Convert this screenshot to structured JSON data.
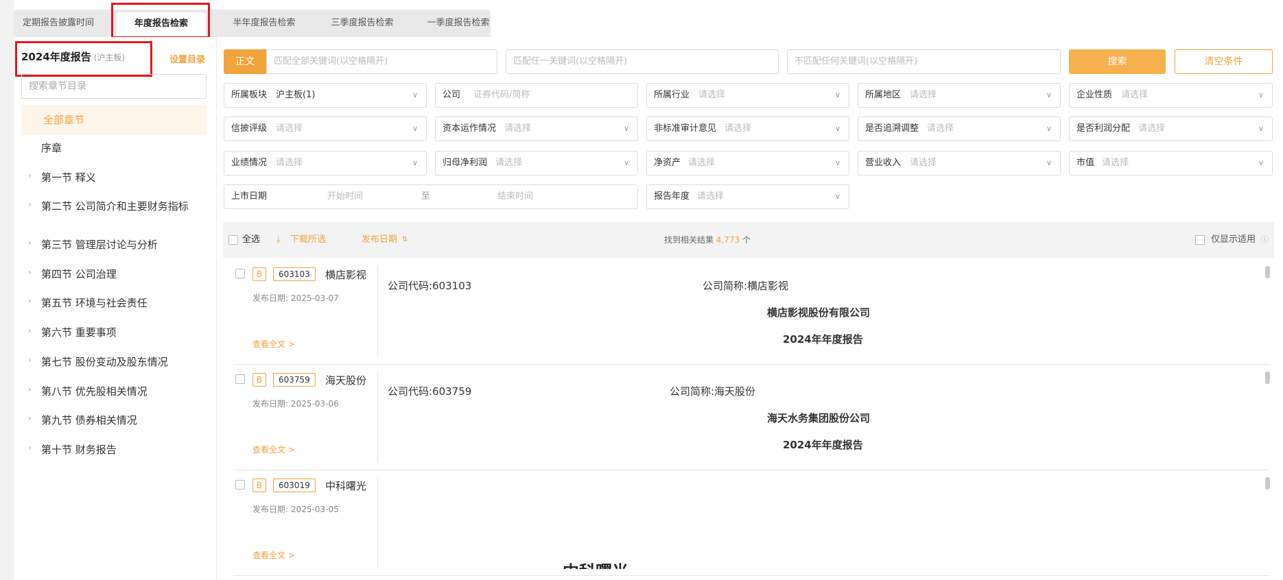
{
  "tabs": [
    {
      "label": "定期报告披露时间"
    },
    {
      "label": "年度报告检索"
    },
    {
      "label": "半年度报告检索"
    },
    {
      "label": "三季度报告检索"
    },
    {
      "label": "一季度报告检索"
    }
  ],
  "sidebar": {
    "title": "2024年度报告",
    "title_sub": "(沪主板)",
    "set_link": "设置目录",
    "search_placeholder": "搜索章节目录",
    "all_chapters": "全部章节",
    "chapters": [
      {
        "label": "序章"
      },
      {
        "label": "第一节 释义"
      },
      {
        "label": "第二节 公司简介和主要财务指标"
      },
      {
        "label": "第三节 管理层讨论与分析"
      },
      {
        "label": "第四节 公司治理"
      },
      {
        "label": "第五节 环境与社会责任"
      },
      {
        "label": "第六节 重要事项"
      },
      {
        "label": "第七节 股份变动及股东情况"
      },
      {
        "label": "第八节 优先股相关情况"
      },
      {
        "label": "第九节 债券相关情况"
      },
      {
        "label": "第十节 财务报告"
      }
    ]
  },
  "search": {
    "body_btn": "正文",
    "any_ph": "匹配全部关键词(以空格隔开)",
    "one_ph": "匹配任一关键词(以空格隔开)",
    "none_ph": "不匹配任何关键词(以空格隔开)",
    "search_btn": "搜索",
    "clear_btn": "清空条件"
  },
  "filters": {
    "board_label": "所属板块",
    "board_value": "沪主板(1)",
    "company_label": "公司",
    "company_ph": "证券代码/简称",
    "industry_label": "所属行业",
    "region_label": "所属地区",
    "nature_label": "企业性质",
    "rating_label": "信披评级",
    "capital_label": "资本运作情况",
    "audit_label": "非标准审计意见",
    "restate_label": "是否追溯调整",
    "dividend_label": "是否利润分配",
    "perf_label": "业绩情况",
    "netprofit_label": "归母净利润",
    "netasset_label": "净资产",
    "revenue_label": "营业收入",
    "mktcap_label": "市值",
    "listdate_label": "上市日期",
    "start_ph": "开始时间",
    "to": "至",
    "end_ph": "结束时间",
    "year_label": "报告年度",
    "select_ph": "请选择"
  },
  "results_bar": {
    "select_all": "全选",
    "download": "下载所选",
    "sort": "发布日期",
    "found_prefix": "找到相关结果",
    "count": "4,773",
    "found_suffix": "个",
    "only_applicable": "仅显示适用"
  },
  "results": [
    {
      "badge": "B",
      "code": "603103",
      "name": "横店影视",
      "date_label": "发布日期:",
      "date": "2025-03-07",
      "view": "查看全文 >",
      "code_line": "公司代码:603103",
      "short_line": "公司简称:横店影视",
      "company_full": "横店影视股份有限公司",
      "report_title": "2024年年度报告"
    },
    {
      "badge": "B",
      "code": "603759",
      "name": "海天股份",
      "date_label": "发布日期:",
      "date": "2025-03-06",
      "view": "查看全文 >",
      "code_line": "公司代码:603759",
      "short_line": "公司简称:海天股份",
      "company_full": "海天水务集团股份公司",
      "report_title": "2024年年度报告"
    },
    {
      "badge": "B",
      "code": "603019",
      "name": "中科曙光",
      "date_label": "发布日期:",
      "date": "2025-03-05",
      "view": "查看全文 >",
      "partial_text": "中科曙光"
    }
  ]
}
